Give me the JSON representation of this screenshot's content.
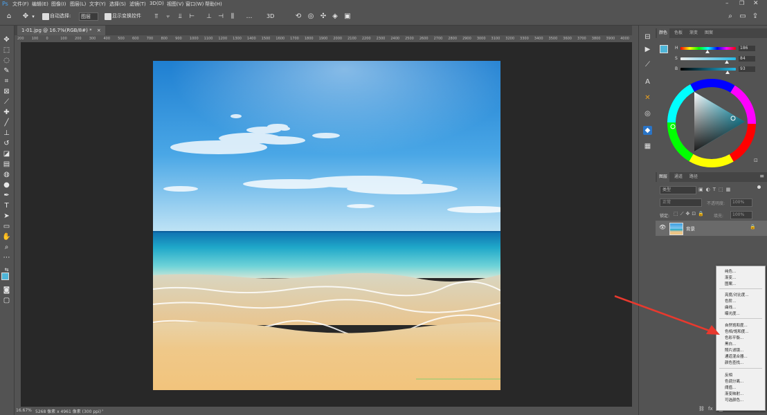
{
  "menubar": {
    "items": [
      "文件(F)",
      "编辑(E)",
      "图像(I)",
      "图层(L)",
      "文字(Y)",
      "选择(S)",
      "滤镜(T)",
      "3D(D)",
      "视图(V)",
      "窗口(W)",
      "帮助(H)"
    ]
  },
  "options": {
    "auto_select_label": "自动选择:",
    "layer_dropdown": "图层",
    "transform_label": "显示变换控件"
  },
  "document": {
    "tab_title": "1-01.jpg @ 16.7%(RGB/8#) *",
    "tab_close": "×"
  },
  "rulers": {
    "h_ticks": [
      "200",
      "100",
      "0",
      "100",
      "200",
      "300",
      "400",
      "500",
      "600",
      "700",
      "800",
      "900",
      "1000",
      "1100",
      "1200",
      "1300",
      "1400",
      "1500",
      "1600",
      "1700",
      "1800",
      "1900",
      "2000",
      "2100",
      "2200",
      "2300",
      "2400",
      "2500",
      "2600",
      "2700",
      "2800",
      "2900",
      "3000",
      "3100",
      "3200",
      "3300",
      "3400",
      "3500",
      "3600",
      "3700",
      "3800",
      "3900",
      "4000"
    ]
  },
  "status": {
    "zoom": "16.67%",
    "doc_info": "5268 像素 x 4961 像素 (300 ppi)",
    "arrow": "›"
  },
  "color_panel": {
    "tabs": [
      "颜色",
      "色板",
      "渐变",
      "图案"
    ],
    "slider_labels": [
      "H",
      "S",
      "B"
    ],
    "slider_values": [
      "186",
      "84",
      "93"
    ],
    "swatch_fg": "#4fb6d8",
    "swatch_bg": "#ffffff"
  },
  "layers_panel": {
    "tabs": [
      "图层",
      "通道",
      "路径"
    ],
    "kind_label": "类型",
    "blend_mode": "正常",
    "opacity_label": "不透明度:",
    "opacity_value": "100%",
    "lock_label": "锁定:",
    "fill_label": "填充:",
    "fill_value": "100%",
    "layer_name": "背景"
  },
  "adjustment_menu": {
    "groups": [
      [
        "纯色...",
        "渐变...",
        "图案..."
      ],
      [
        "亮度/对比度...",
        "色阶...",
        "曲线...",
        "曝光度..."
      ],
      [
        "自然饱和度...",
        "色相/饱和度...",
        "色彩平衡...",
        "黑白...",
        "照片滤镜...",
        "通道混合器...",
        "颜色查找..."
      ],
      [
        "反相",
        "色调分离...",
        "阈值...",
        "渐变映射...",
        "可选颜色..."
      ]
    ]
  },
  "colors": {
    "accent_arrow": "#e8392e",
    "canvas_bg": "#282828",
    "ui_bg": "#535353"
  }
}
